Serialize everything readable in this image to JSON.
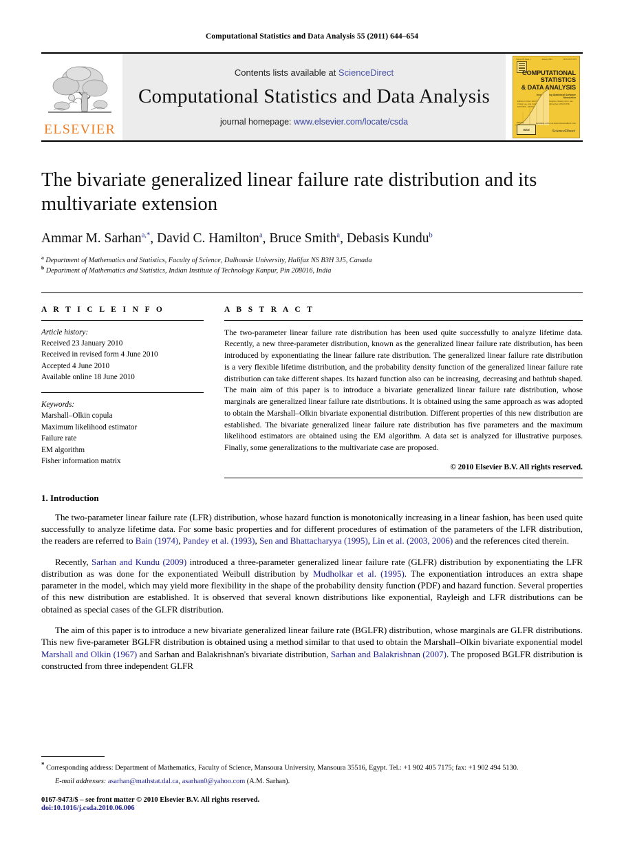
{
  "running_head": "Computational Statistics and Data Analysis 55 (2011) 644–654",
  "masthead": {
    "contents_prefix": "Contents lists available at ",
    "sciencedirect": "ScienceDirect",
    "journal_name": "Computational Statistics and Data Analysis",
    "homepage_prefix": "journal homepage: ",
    "homepage_url": "www.elsevier.com/locate/csda",
    "publisher_logo_text": "ELSEVIER",
    "logo_icon": "elsevier-tree-icon"
  },
  "cover": {
    "title_line1": "COMPUTATIONAL",
    "title_line2": "STATISTICS",
    "title_line3": "& DATA ANALYSIS",
    "subtitle": "Incorporating  Statistical Software Newsletter",
    "top_left": "Volume 55  Issue 1",
    "top_center": "January 2011",
    "top_right": "ISSN 0167-9473",
    "editors": "Editors-in-Chief:\nErricos John Kontoghiorghes, Stanley Azen,\nJae Chang Lee, Ana Colubi, Erricos Kontoghiorghes\nASSOCIATE EDITORS · EDITORIAL BOARD",
    "barcode_label": "ISSN",
    "elsevier_note": "Elsevier",
    "sciencedirect_note": "Available online at www.sciencedirect.com",
    "sciencedirect_logo": "ScienceDirect"
  },
  "article": {
    "title": "The bivariate generalized linear failure rate distribution and its multivariate extension",
    "authors": [
      {
        "name": "Ammar M. Sarhan",
        "sup": "a,*"
      },
      {
        "name": "David C. Hamilton",
        "sup": "a"
      },
      {
        "name": "Bruce Smith",
        "sup": "a"
      },
      {
        "name": "Debasis Kundu",
        "sup": "b"
      }
    ],
    "affiliations": [
      {
        "mark": "a",
        "text": "Department of Mathematics and Statistics, Faculty of Science, Dalhousie University, Halifax NS B3H 3J5, Canada"
      },
      {
        "mark": "b",
        "text": "Department of Mathematics and Statistics, Indian Institute of Technology Kanpur, Pin 208016, India"
      }
    ]
  },
  "info": {
    "heading": "A R T I C L E   I N F O",
    "history_label": "Article history:",
    "history": [
      "Received 23 January 2010",
      "Received in revised form 4 June 2010",
      "Accepted 4 June 2010",
      "Available online 18 June 2010"
    ],
    "keywords_label": "Keywords:",
    "keywords": [
      "Marshall–Olkin copula",
      "Maximum likelihood estimator",
      "Failure rate",
      "EM algorithm",
      "Fisher information matrix"
    ]
  },
  "abstract": {
    "heading": "A B S T R A C T",
    "text": "The two-parameter linear failure rate distribution has been used quite successfully to analyze lifetime data. Recently, a new three-parameter distribution, known as the generalized linear failure rate distribution, has been introduced by exponentiating the linear failure rate distribution. The generalized linear failure rate distribution is a very flexible lifetime distribution, and the probability density function of the generalized linear failure rate distribution can take different shapes. Its hazard function also can be increasing, decreasing and bathtub shaped. The main aim of this paper is to introduce a bivariate generalized linear failure rate distribution, whose marginals are generalized linear failure rate distributions. It is obtained using the same approach as was adopted to obtain the Marshall–Olkin bivariate exponential distribution. Different properties of this new distribution are established. The bivariate generalized linear failure rate distribution has five parameters and the maximum likelihood estimators are obtained using the EM algorithm. A data set is analyzed for illustrative purposes. Finally, some generalizations to the multivariate case are proposed.",
    "copyright": "© 2010 Elsevier B.V. All rights reserved."
  },
  "body": {
    "section_title": "1.  Introduction",
    "paragraph1": {
      "s1": "The two-parameter linear failure rate (LFR) distribution, whose hazard function is monotonically increasing in a linear fashion, has been used quite successfully to analyze lifetime data. For some basic properties and for different procedures of estimation of the parameters of the LFR distribution, the readers are referred to ",
      "c1": "Bain (1974)",
      "s2": ", ",
      "c2": "Pandey et al. (1993)",
      "s3": ", ",
      "c3": "Sen and Bhattacharyya (1995)",
      "s4": ", ",
      "c4": "Lin et al. (2003, 2006)",
      "s5": " and the references cited therein."
    },
    "paragraph2": {
      "s1": "Recently, ",
      "c1": "Sarhan and Kundu (2009)",
      "s2": " introduced a three-parameter generalized linear failure rate (GLFR) distribution by exponentiating the LFR distribution as was done for the exponentiated Weibull distribution by ",
      "c2": "Mudholkar et al. (1995)",
      "s3": ". The exponentiation introduces an extra shape parameter in the model, which may yield more flexibility in the shape of the probability density function (PDF) and hazard function. Several properties of this new distribution are established. It is observed that several known distributions like exponential, Rayleigh and LFR distributions can be obtained as special cases of the GLFR distribution."
    },
    "paragraph3": {
      "s1": "The aim of this paper is to introduce a new bivariate generalized linear failure rate (BGLFR) distribution, whose marginals are GLFR distributions. This new five-parameter BGLFR distribution is obtained using a method similar to that used to obtain the Marshall–Olkin bivariate exponential model ",
      "c1": "Marshall and Olkin (1967)",
      "s2": " and Sarhan and Balakrishnan's bivariate distribution, ",
      "c2": "Sarhan and Balakrishnan (2007)",
      "s3": ". The proposed BGLFR distribution is constructed from three independent GLFR"
    }
  },
  "footnotes": {
    "corresponding_mark": "*",
    "corresponding": "Corresponding address: Department of Mathematics, Faculty of Science, Mansoura University, Mansoura 35516, Egypt. Tel.: +1 902 405 7175; fax: +1 902 494 5130.",
    "email_label": "E-mail addresses:",
    "email1": "asarhan@mathstat.dal.ca",
    "email_sep": ", ",
    "email2": "asarhan0@yahoo.com",
    "email_suffix": " (A.M. Sarhan).",
    "issn_line": "0167-9473/$ – see front matter © 2010 Elsevier B.V. All rights reserved.",
    "doi": "doi:10.1016/j.csda.2010.06.006"
  }
}
